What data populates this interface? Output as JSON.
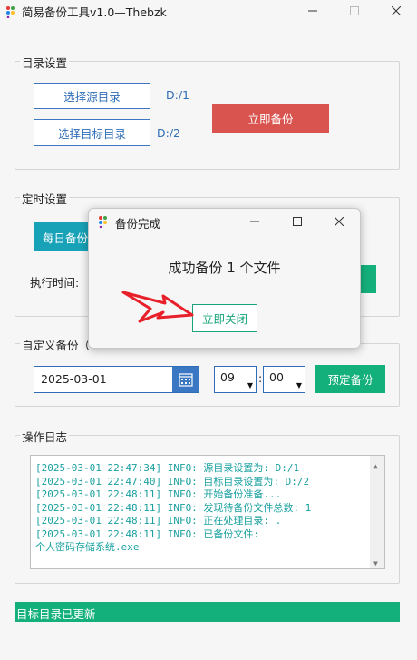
{
  "window": {
    "title": "简易备份工具v1.0—Thebzk",
    "logo_icon": "app-dots-icon",
    "minimize_icon": "minimize-icon",
    "maximize_icon": "maximize-icon",
    "close_icon": "close-icon"
  },
  "dir_settings": {
    "legend": "目录设置",
    "select_source_label": "选择源目录",
    "source_path": "D:/1",
    "select_target_label": "选择目标目录",
    "target_path": "D:/2",
    "backup_now_label": "立即备份"
  },
  "timer_settings": {
    "legend": "定时设置",
    "daily_backup_label": "每日备份",
    "exec_time_label": "执行时间:"
  },
  "custom_backup": {
    "legend": "自定义备份（",
    "date_value": "2025-03-01",
    "calendar_icon": "calendar-icon",
    "hour_value": "09",
    "minute_value": "00",
    "separator": ":",
    "schedule_label": "预定备份"
  },
  "log": {
    "legend": "操作日志",
    "lines": [
      "[2025-03-01 22:47:34] INFO: 源目录设置为: D:/1",
      "[2025-03-01 22:47:40] INFO: 目标目录设置为: D:/2",
      "[2025-03-01 22:48:11] INFO: 开始备份准备...",
      "[2025-03-01 22:48:11] INFO: 发现待备份文件总数: 1",
      "[2025-03-01 22:48:11] INFO: 正在处理目录: .",
      "[2025-03-01 22:48:11] INFO: 已备份文件:",
      "个人密码存储系统.exe"
    ]
  },
  "status_bar": {
    "text": "目标目录已更新"
  },
  "dialog": {
    "title": "备份完成",
    "message": "成功备份 1 个文件",
    "close_label": "立即关闭"
  },
  "colors": {
    "accent_blue": "#2f6db8",
    "red": "#d9534f",
    "teal": "#17a2b8",
    "green": "#14b07c",
    "log_text": "#1aa0a0",
    "arrow_red": "#e8202a"
  }
}
